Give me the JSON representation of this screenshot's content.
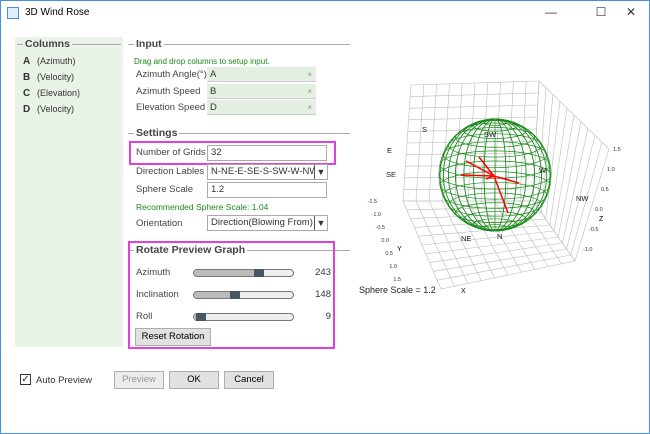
{
  "window": {
    "title": "3D Wind Rose",
    "minimize": "—",
    "maximize": "☐",
    "close": "✕"
  },
  "columns": {
    "title": "Columns",
    "items": [
      {
        "letter": "A",
        "desc": "(Azimuth)"
      },
      {
        "letter": "B",
        "desc": "(Velocity)"
      },
      {
        "letter": "C",
        "desc": "(Elevation)"
      },
      {
        "letter": "D",
        "desc": "(Velocity)"
      }
    ]
  },
  "input": {
    "title": "Input",
    "hint": "Drag and drop columns to setup input.",
    "rows": [
      {
        "label": "Azimuth Angle(°)",
        "value": "A"
      },
      {
        "label": "Azimuth Speed",
        "value": "B"
      },
      {
        "label": "Elevation Speed",
        "value": "D"
      }
    ],
    "clear": "×"
  },
  "settings": {
    "title": "Settings",
    "grids_label": "Number of Grids",
    "grids_value": "32",
    "dir_label": "Direction Lables",
    "dir_value": "N-NE-E-SE-S-SW-W-NW",
    "scale_label": "Sphere Scale",
    "scale_value": "1.2",
    "recommended": "Recommended Sphere Scale: 1.04",
    "orient_label": "Orientation",
    "orient_value": "Direction(Blowing From)"
  },
  "rotate": {
    "title": "Rotate Preview Graph",
    "sliders": [
      {
        "label": "Azimuth",
        "value": "243",
        "fraction": 0.675
      },
      {
        "label": "Inclination",
        "value": "148",
        "fraction": 0.41
      },
      {
        "label": "Roll",
        "value": "9",
        "fraction": 0.025
      }
    ],
    "reset": "Reset Rotation"
  },
  "preview": {
    "caption": "Sphere Scale = 1.2",
    "directions": [
      "S",
      "SW",
      "W",
      "NW",
      "N",
      "NE",
      "E",
      "SE"
    ],
    "y_ticks": [
      "-1.5",
      "-1.0",
      "-0.5",
      "0.0",
      "0.5",
      "1.0",
      "1.5"
    ],
    "z_ticks": [
      "1.5",
      "1.0",
      "0.5",
      "0.0",
      "-0.5",
      "-1.0"
    ],
    "x_label": "X",
    "y_label": "Y",
    "z_label": "Z",
    "sphere_color": "#1a8a1a",
    "vector_color": "#ff0000"
  },
  "footer": {
    "auto_preview": "Auto Preview",
    "auto_checked": true,
    "preview": "Preview",
    "ok": "OK",
    "cancel": "Cancel"
  }
}
